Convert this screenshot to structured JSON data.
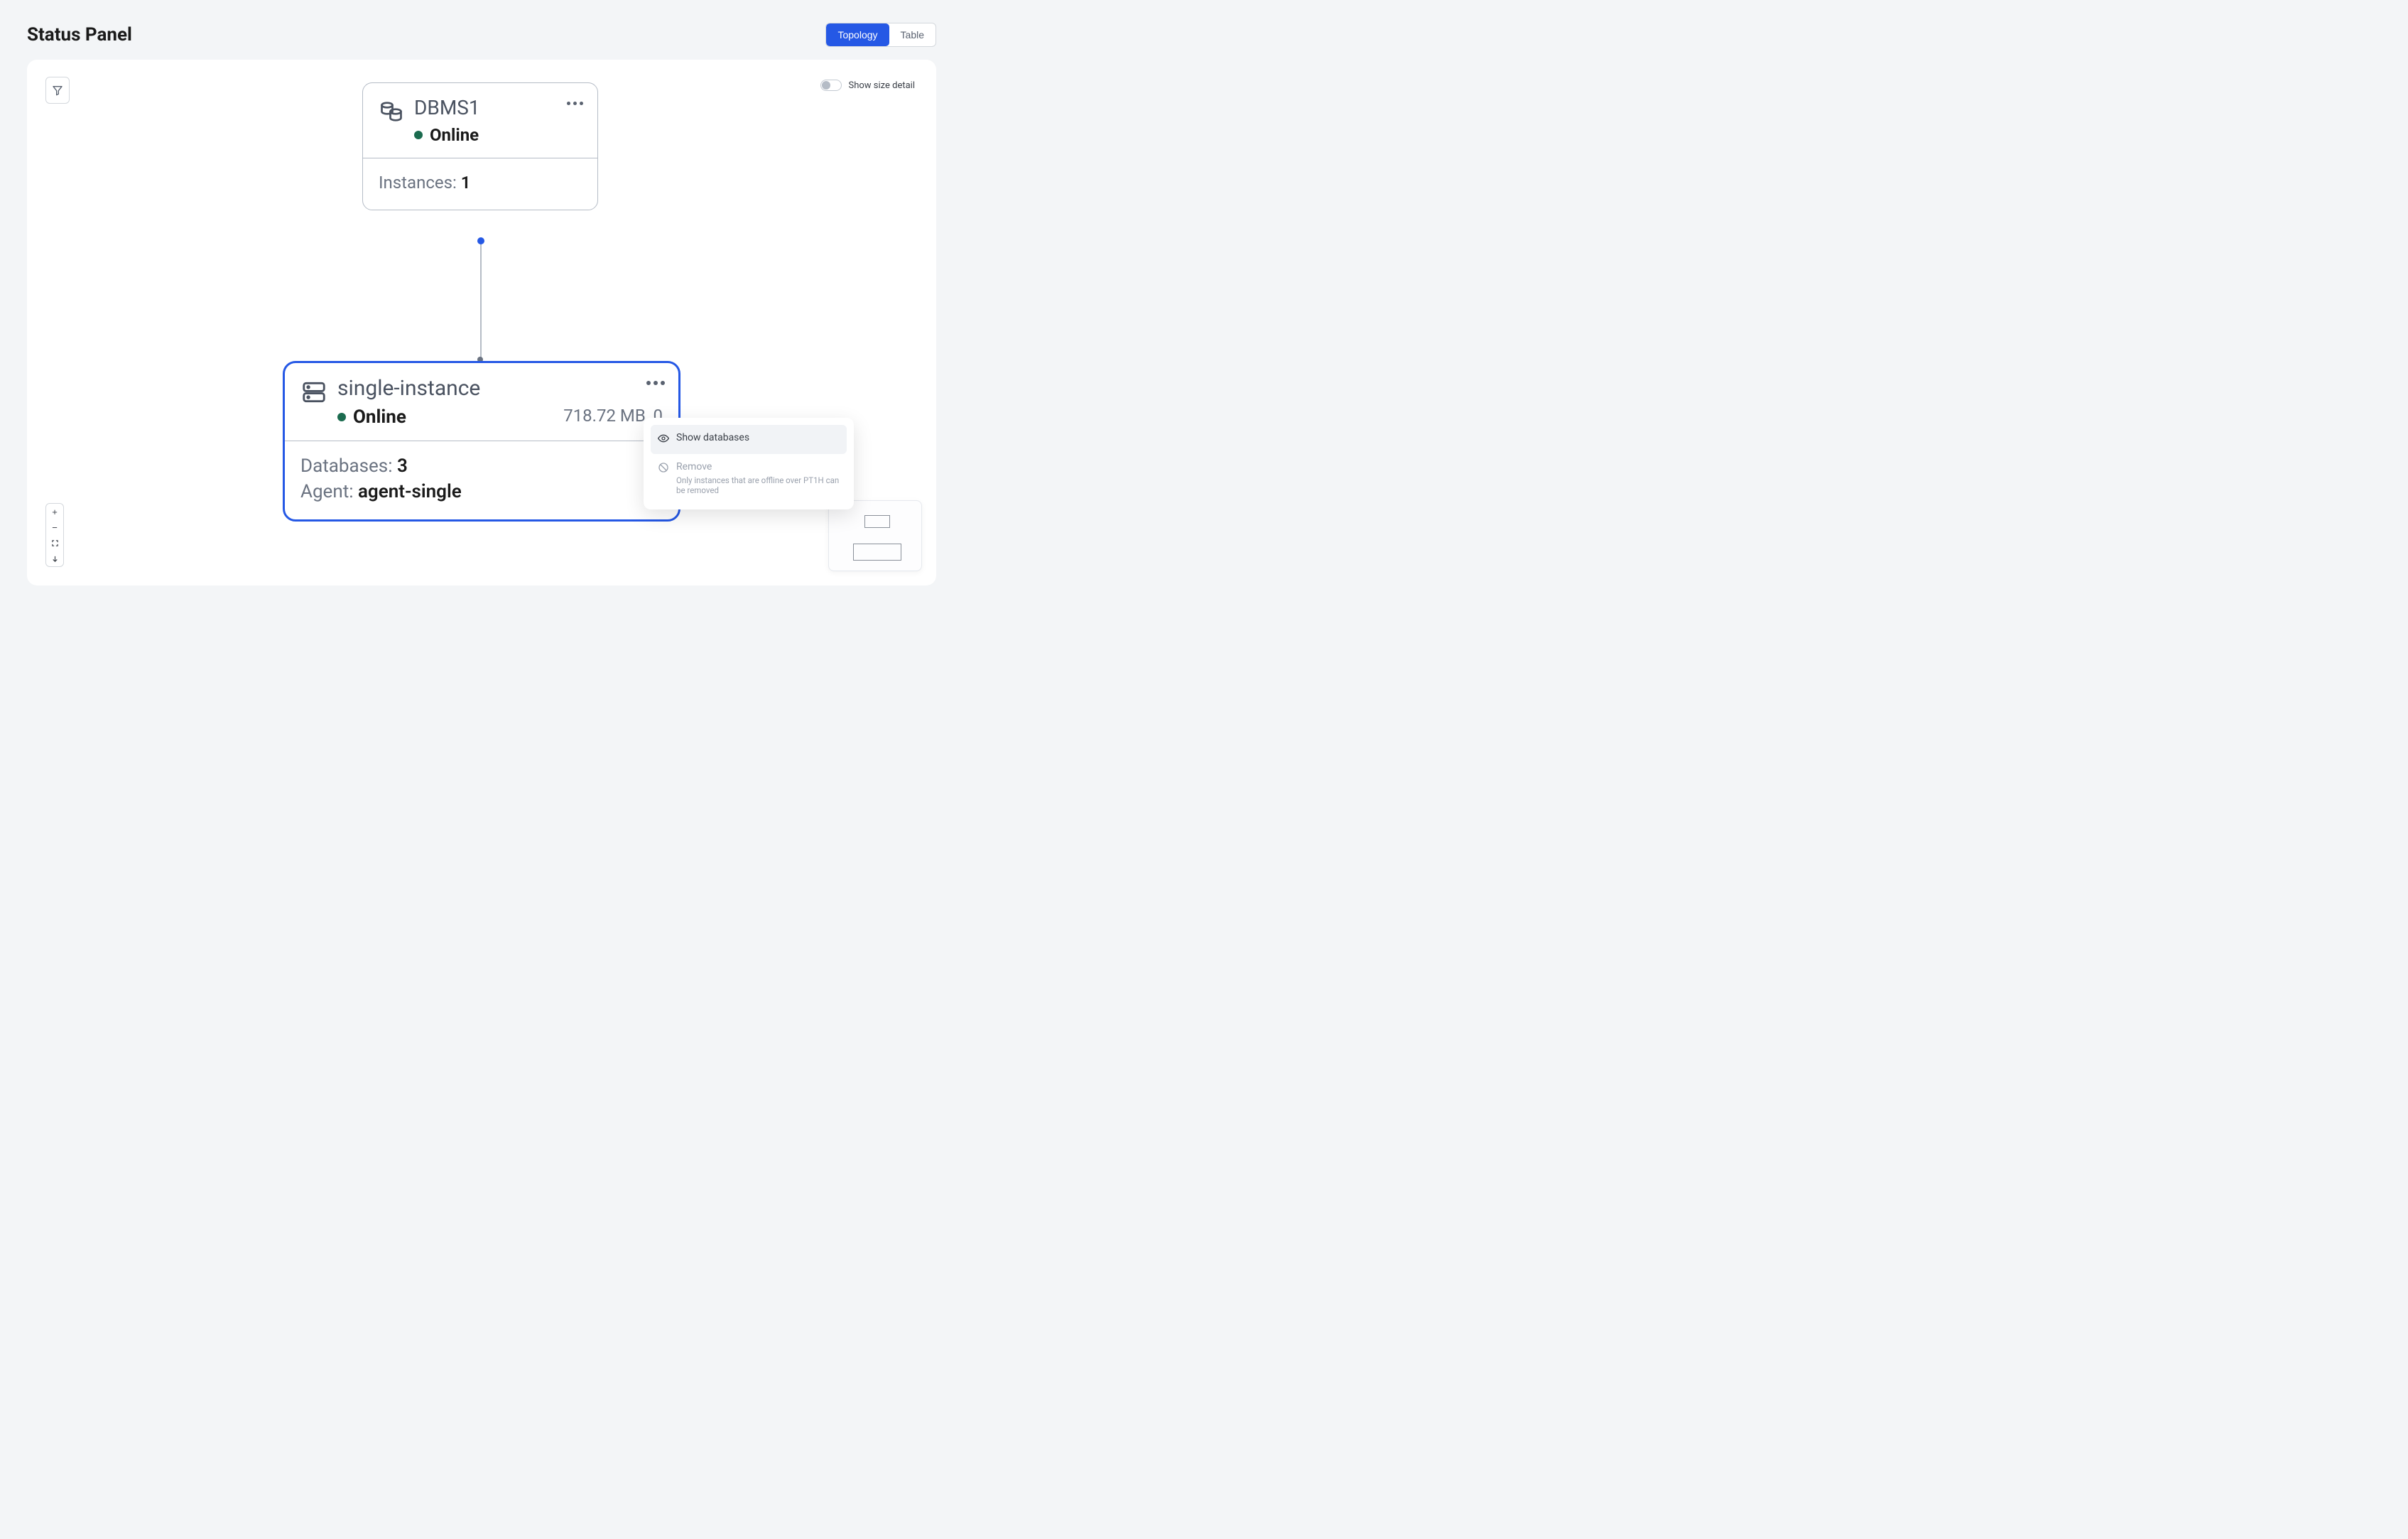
{
  "header": {
    "title": "Status Panel",
    "view_topology": "Topology",
    "view_table": "Table"
  },
  "toggle": {
    "label": "Show size detail"
  },
  "dbms": {
    "name": "DBMS1",
    "status": "Online",
    "instances_label": "Instances:",
    "instances_count": "1"
  },
  "instance": {
    "name": "single-instance",
    "status": "Online",
    "size": "718.72 MB, 0",
    "databases_label": "Databases:",
    "databases_count": "3",
    "agent_label": "Agent:",
    "agent_name": "agent-single"
  },
  "ctx": {
    "show_db": "Show databases",
    "remove": "Remove",
    "remove_hint": "Only instances that are offline over PT1H can be removed"
  }
}
